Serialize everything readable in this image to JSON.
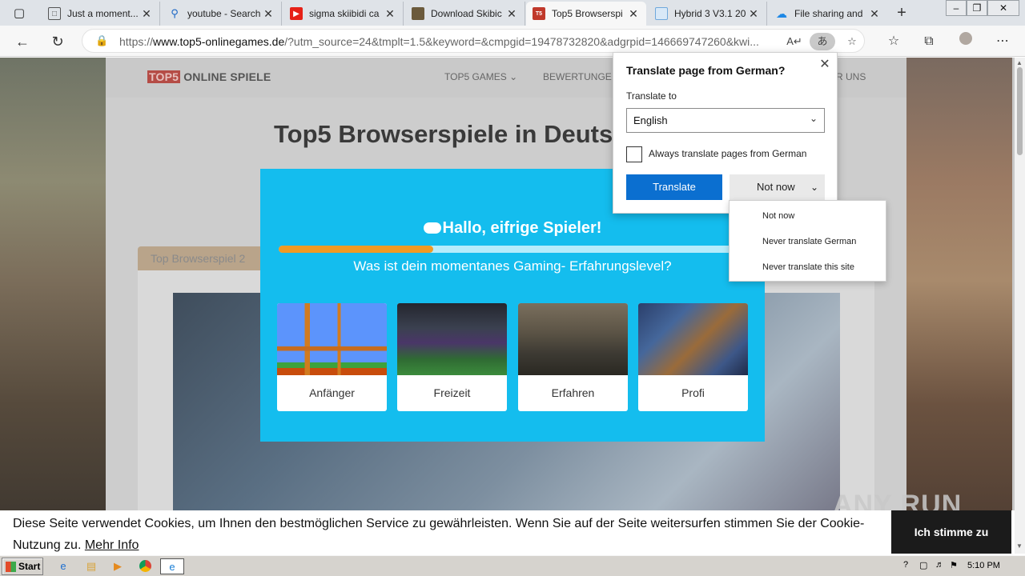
{
  "browser": {
    "tabs": [
      {
        "title": "Just a moment...",
        "favicon": "document-icon",
        "active": false
      },
      {
        "title": "youtube - Search",
        "favicon": "search-icon",
        "active": false
      },
      {
        "title": "sigma skiibidi ca",
        "favicon": "youtube-icon",
        "active": false
      },
      {
        "title": "Download Skibic",
        "favicon": "site-icon",
        "active": false
      },
      {
        "title": "Top5 Browserspi",
        "favicon": "top5-icon",
        "active": true
      },
      {
        "title": "Hybrid 3 V3.1 20",
        "favicon": "file-icon",
        "active": false
      },
      {
        "title": "File sharing and",
        "favicon": "cloud-icon",
        "active": false
      }
    ],
    "close_glyph": "✕",
    "new_tab_glyph": "+",
    "url_prefix": "https://",
    "url_domain": "www.top5-onlinegames.de",
    "url_rest": "/?utm_source=24&tmplt=1.5&keyword=&cmpgid=19478732820&adgrpid=146669747260&kwi..."
  },
  "site": {
    "logo_mark": "TOP5",
    "logo_text": "ONLINE SPIELE",
    "nav": [
      "TOP5 GAMES",
      "BEWERTUNGE",
      "ER UNS"
    ],
    "title": "Top5 Browserspiele in Deutsc",
    "section_tab": "Top Browserspiel 2"
  },
  "quiz": {
    "title": "Hallo, eifrige Spieler!",
    "question": "Was ist dein momentanes Gaming- Erfahrungslevel?",
    "progress": 0.33,
    "options": [
      "Anfänger",
      "Freizeit",
      "Erfahren",
      "Profi"
    ]
  },
  "translate": {
    "title": "Translate page from German?",
    "translate_to_label": "Translate to",
    "language": "English",
    "always_label": "Always translate pages from German",
    "translate_button": "Translate",
    "not_now_button": "Not now",
    "menu": [
      "Not now",
      "Never translate German",
      "Never translate this site"
    ]
  },
  "cookie": {
    "text": "Diese Seite verwendet Cookies, um Ihnen den bestmöglichen Service zu gewährleisten. Wenn Sie auf der Seite weitersurfen stimmen Sie der Cookie-Nutzung zu.",
    "more": "Mehr Info",
    "accept": "Ich stimme zu"
  },
  "watermark": "ANY RUN",
  "taskbar": {
    "start": "Start",
    "clock": "5:10 PM"
  },
  "colors": {
    "quiz_bg": "#14bdee",
    "progress_fill": "#f09a23",
    "translate_btn": "#0b6fd0"
  }
}
